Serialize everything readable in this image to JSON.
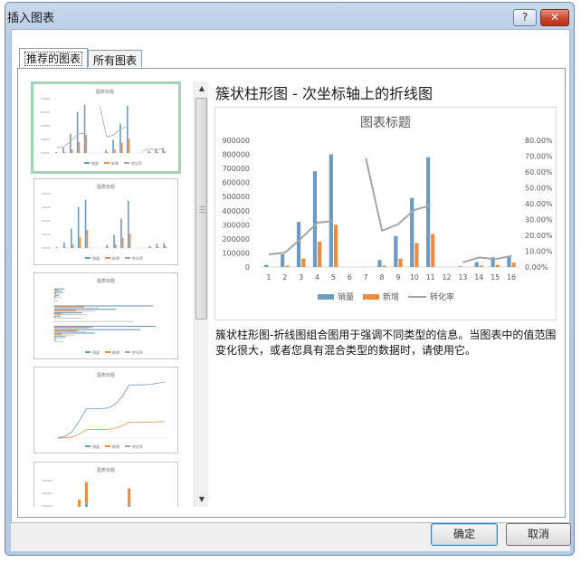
{
  "window": {
    "title": "插入图表",
    "help_label": "?",
    "close_label": "✕"
  },
  "tabs": [
    {
      "label": "推荐的图表",
      "active": true
    },
    {
      "label": "所有图表",
      "active": false
    }
  ],
  "selected_chart": {
    "type_title": "簇状柱形图 - 次坐标轴上的折线图",
    "description": "簇状柱形图-折线图组合图用于强调不同类型的信息。当图表中的值范围变化很大，或者您具有混合类型的数据时，请使用它。"
  },
  "buttons": {
    "ok": "确定",
    "cancel": "取消"
  },
  "colors": {
    "sales": "#6b9ac4",
    "new": "#ed8b3f",
    "rate": "#a6a6a6",
    "selection": "#a3d4b6"
  },
  "chart_data": {
    "type": "bar",
    "title": "图表标题",
    "categories": [
      "1",
      "2",
      "3",
      "4",
      "5",
      "6",
      "7",
      "8",
      "9",
      "10",
      "11",
      "12",
      "13",
      "14",
      "15",
      "16"
    ],
    "y_ticks": [
      "0",
      "100000",
      "200000",
      "300000",
      "400000",
      "500000",
      "600000",
      "700000",
      "800000",
      "900000"
    ],
    "y2_ticks": [
      "0.00%",
      "10.00%",
      "20.00%",
      "30.00%",
      "40.00%",
      "50.00%",
      "60.00%",
      "70.00%",
      "80.00%"
    ],
    "ylim": [
      0,
      900000
    ],
    "y2lim": [
      0,
      0.8
    ],
    "series": [
      {
        "name": "销量",
        "kind": "bar",
        "values": [
          15000,
          90000,
          320000,
          680000,
          800000,
          0,
          0,
          50000,
          220000,
          490000,
          780000,
          0,
          5000,
          35000,
          70000,
          80000
        ]
      },
      {
        "name": "新增",
        "kind": "bar",
        "values": [
          0,
          10000,
          60000,
          180000,
          300000,
          0,
          0,
          10000,
          60000,
          170000,
          235000,
          0,
          0,
          10000,
          15000,
          30000
        ]
      },
      {
        "name": "转化率",
        "kind": "line",
        "axis": "secondary",
        "values": [
          0.08,
          0.09,
          0.18,
          0.28,
          0.29,
          null,
          0.69,
          0.23,
          0.27,
          0.36,
          0.39,
          null,
          0.03,
          0.06,
          0.05,
          0.07
        ]
      }
    ],
    "legend_position": "bottom",
    "grid": false
  },
  "thumbnails": [
    {
      "title": "图表标题",
      "kind": "combo",
      "selected": true,
      "legend": [
        "销量",
        "新增",
        "转化率"
      ]
    },
    {
      "title": "图表标题",
      "kind": "bar",
      "selected": false,
      "legend": [
        "销量",
        "新增",
        "转化率"
      ]
    },
    {
      "title": "图表标题",
      "kind": "hbar",
      "selected": false,
      "legend": [
        "销量",
        "新增",
        "转化率"
      ]
    },
    {
      "title": "图表标题",
      "kind": "line",
      "selected": false,
      "legend": [
        "销量",
        "新增",
        "转化率"
      ]
    },
    {
      "title": "图表标题",
      "kind": "stacked",
      "selected": false,
      "legend": []
    }
  ]
}
